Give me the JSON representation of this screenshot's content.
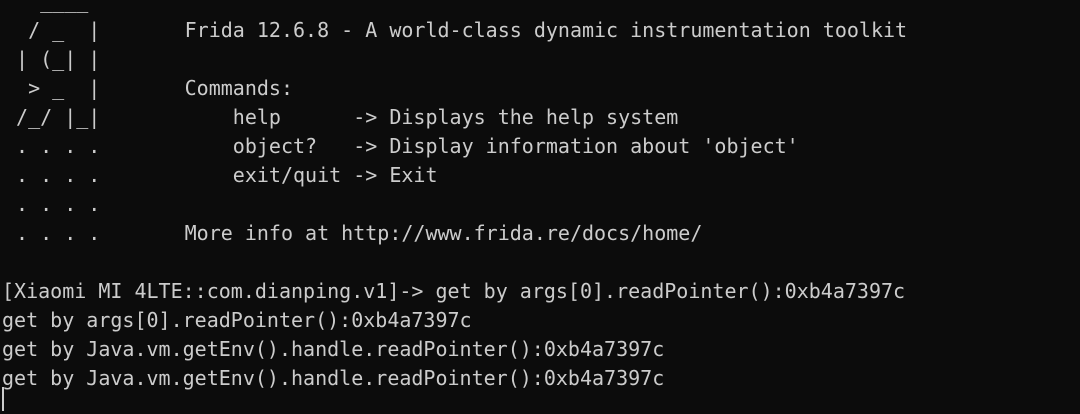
{
  "banner": {
    "ascii": [
      "   ____",
      "  / _  |",
      " | (_| |",
      "  > _  |",
      " /_/ |_|",
      " . . . .",
      " . . . .",
      " . . . .",
      " . . . ."
    ],
    "text": [
      "",
      "Frida 12.6.8 - A world-class dynamic instrumentation toolkit",
      "",
      "Commands:",
      "    help      -> Displays the help system",
      "    object?   -> Display information about 'object'",
      "    exit/quit -> Exit",
      "",
      "More info at http://www.frida.re/docs/home/"
    ]
  },
  "output": {
    "prompt": "[Xiaomi MI 4LTE::com.dianping.v1]-> ",
    "lines": [
      "get by args[0].readPointer():0xb4a7397c",
      "get by args[0].readPointer():0xb4a7397c",
      "get by Java.vm.getEnv().handle.readPointer():0xb4a7397c",
      "get by Java.vm.getEnv().handle.readPointer():0xb4a7397c"
    ]
  }
}
